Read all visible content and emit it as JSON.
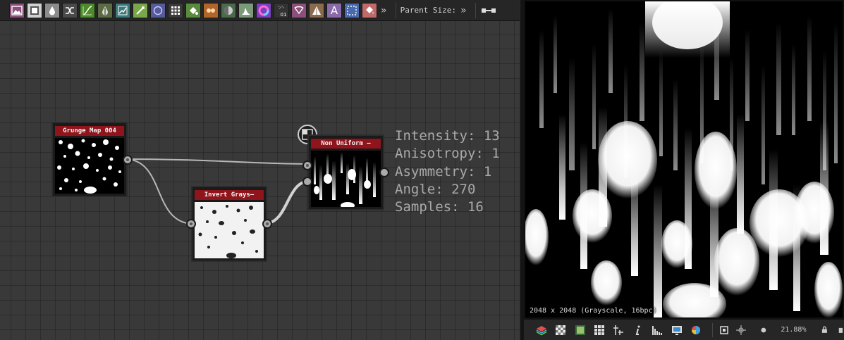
{
  "toolbar": {
    "buttons": [
      {
        "icon": "bitmap-icon",
        "color": "#8b4f7c"
      },
      {
        "icon": "svg-icon",
        "color": "#d0d0d0"
      },
      {
        "icon": "drop-icon",
        "color": "#8b8b8b"
      },
      {
        "icon": "shuffle-icon",
        "color": "#4a4a4a"
      },
      {
        "icon": "curve-icon",
        "color": "#4c8a2b"
      },
      {
        "icon": "blur-drop-icon",
        "color": "#5c6b42"
      },
      {
        "icon": "warp-icon",
        "color": "#3a7a7a"
      },
      {
        "icon": "gradient-icon",
        "color": "#78a84a"
      },
      {
        "icon": "circle-icon",
        "color": "#555a9a"
      },
      {
        "icon": "grid-icon",
        "color": "#3a3a3a"
      },
      {
        "icon": "fill-icon",
        "color": "#5a8b3a"
      },
      {
        "icon": "blend-icon",
        "color": "#b0652a"
      },
      {
        "icon": "sphere-icon",
        "color": "#4b6b4b"
      },
      {
        "icon": "histogram-icon",
        "color": "#7a9a7a"
      },
      {
        "icon": "color-wheel-icon",
        "color": "#7a40c0"
      },
      {
        "icon": "noise-icon",
        "color": "#333333",
        "label": "01"
      },
      {
        "icon": "transform-icon",
        "color": "#8b4f7c"
      },
      {
        "icon": "triangle-icon",
        "color": "#8b6b4f"
      },
      {
        "icon": "text-icon",
        "color": "#8a6aa8",
        "label": "A"
      },
      {
        "icon": "selection-icon",
        "color": "#4a6ab0"
      },
      {
        "icon": "paint-bucket-icon",
        "color": "#c06a6a"
      }
    ],
    "more_glyph": "»",
    "parent_size_label": "Parent Size:",
    "parent_more_glyph": "»"
  },
  "nodes": {
    "grunge_map": {
      "title": "Grunge Map 004"
    },
    "invert_grayscale": {
      "title": "Invert Grays—"
    },
    "non_uniform": {
      "title": "Non Uniform —"
    }
  },
  "params": {
    "intensity": "Intensity: 13",
    "anisotropy": "Anisotropy: 1",
    "asymmetry": "Asymmetry: 1",
    "angle": "Angle: 270",
    "samples": "Samples: 16"
  },
  "view": {
    "resolution_label": "2048 x 2048 (Grayscale, 16bpc)",
    "zoom": "21.88%"
  },
  "view_toolbar": {
    "buttons": [
      {
        "icon": "layers-icon"
      },
      {
        "icon": "checker-icon"
      },
      {
        "icon": "color-channel-icon"
      },
      {
        "icon": "tiling-grid-icon"
      },
      {
        "icon": "sample-icon"
      },
      {
        "icon": "info-icon"
      },
      {
        "icon": "histogram-view-icon"
      },
      {
        "icon": "display-icon"
      },
      {
        "icon": "color-picker-icon"
      },
      {
        "icon": "fit-icon"
      },
      {
        "icon": "pan-icon"
      }
    ]
  }
}
